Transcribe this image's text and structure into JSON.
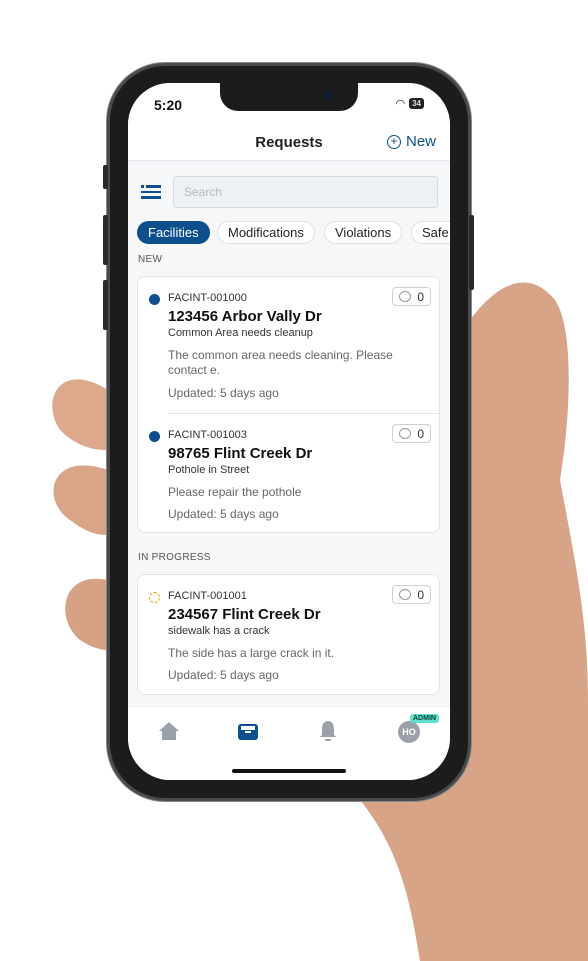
{
  "status": {
    "time": "5:20",
    "battery": "34"
  },
  "header": {
    "title": "Requests",
    "new_label": "New"
  },
  "search": {
    "placeholder": "Search"
  },
  "chips": [
    "Facilities",
    "Modifications",
    "Violations",
    "Safe"
  ],
  "sections": [
    {
      "label": "NEW",
      "items": [
        {
          "id": "FACINT-001000",
          "address": "123456 Arbor Vally Dr",
          "subject": "Common Area needs cleanup",
          "description": "The common area needs cleaning.   Please contact e.",
          "updated": "Updated: 5 days ago",
          "comments": "0",
          "status_color": "#0c4f8c"
        },
        {
          "id": "FACINT-001003",
          "address": "98765 Flint Creek Dr",
          "subject": "Pothole in Street",
          "description": "Please repair the pothole",
          "updated": "Updated: 5 days ago",
          "comments": "0",
          "status_color": "#0c4f8c"
        }
      ]
    },
    {
      "label": "IN PROGRESS",
      "items": [
        {
          "id": "FACINT-001001",
          "address": "234567 Flint Creek Dr",
          "subject": "sidewalk has a crack",
          "description": "The side has a large crack in it.",
          "updated": "Updated: 5 days ago",
          "comments": "0",
          "status_color": "#e6a21a"
        }
      ]
    }
  ],
  "tabbar": {
    "avatar": "HO",
    "badge": "ADMIN",
    "active": "requests"
  },
  "colors": {
    "accent": "#0c4f8c",
    "badge": "#5fe0c8",
    "inactive": "#9aa1a9"
  }
}
